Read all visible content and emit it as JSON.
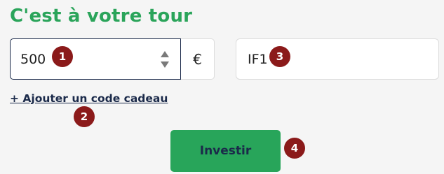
{
  "heading": "C'est à votre tour",
  "amount": {
    "value": "500",
    "currency": "€"
  },
  "code": {
    "value": "IF1"
  },
  "gift_link": "+ Ajouter un code cadeau",
  "submit_label": "Investir",
  "markers": [
    "1",
    "2",
    "3",
    "4"
  ],
  "colors": {
    "brand_green": "#2aa45a",
    "navy": "#1b2a4a",
    "marker_red": "#8b1a1a"
  }
}
